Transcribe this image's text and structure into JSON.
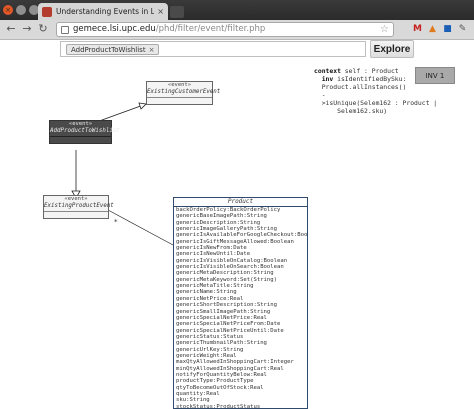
{
  "browser": {
    "tab_title": "Understanding Events in L...",
    "tab_close": "×",
    "url_host": "gemece.lsi.upc.edu",
    "url_path": "/phd/filter/event/filter.php",
    "nav_back": "←",
    "nav_forward": "→",
    "nav_reload": "↻",
    "window_close": "×",
    "extensions": [
      {
        "name": "gmail",
        "glyph": "M",
        "color": "#c5221f"
      },
      {
        "name": "ext-orange",
        "glyph": "▲",
        "color": "#e07a1f"
      },
      {
        "name": "ext-blue",
        "glyph": "■",
        "color": "#1a5fb4"
      },
      {
        "name": "wrench",
        "glyph": "✎",
        "color": "#555555"
      }
    ]
  },
  "toolbar": {
    "search_chip": "AddProductToWishlist",
    "chip_remove": "×",
    "explore_label": "Explore"
  },
  "ocl": {
    "line1_kw": "context",
    "line1": " self : Product",
    "line2_kw": "inv",
    "line2": " isIdentifiedBySku:",
    "line3": "Product.allInstances()",
    "line4": "-",
    "line5": ">isUnique(Selem162 : Product |",
    "line6": "Selem162.sku)"
  },
  "inv_button": "INV 1",
  "classes": {
    "existing_customer_event": {
      "stereotype": "«event»",
      "name": "ExistingCustomerEvent"
    },
    "add_product_to_wishlist": {
      "stereotype": "«event»",
      "name": "AddProductToWishlist"
    },
    "existing_product_event": {
      "stereotype": "«event»",
      "name": "ExistingProductEvent"
    }
  },
  "product": {
    "name": "Product",
    "attributes": [
      "backOrderPolicy:BackOrderPolicy",
      "genericBaseImagePath:String",
      "genericDescription:String",
      "genericImageGalleryPath:String",
      "genericIsAvailableForGoogleCheckout:Boolean",
      "genericIsGiftMessageAllowed:Boolean",
      "genericIsNewFrom:Date",
      "genericIsNewUntil:Date",
      "genericIsVisibleOnCatalog:Boolean",
      "genericIsVisibleOnSearch:Boolean",
      "genericMetaDescription:String",
      "genericMetaKeyword:Set(String)",
      "genericMetaTitle:String",
      "genericName:String",
      "genericNetPrice:Real",
      "genericShortDescription:String",
      "genericSmallImagePath:String",
      "genericSpecialNetPrice:Real",
      "genericSpecialNetPriceFrom:Date",
      "genericSpecialNetPriceUntil:Date",
      "genericStatus:Status",
      "genericThumbnailPath:String",
      "genericUrlKey:String",
      "genericWeight:Real",
      "maxQtyAllowedInShoppingCart:Integer",
      "minQtyAllowedInShoppingCart:Real",
      "notifyForQuantityBelow:Real",
      "productType:ProductType",
      "qtyToBecomeOutOfStock:Real",
      "quantity:Real",
      "sku:String",
      "stockStatus:ProductStatus"
    ]
  },
  "association_label": "*"
}
